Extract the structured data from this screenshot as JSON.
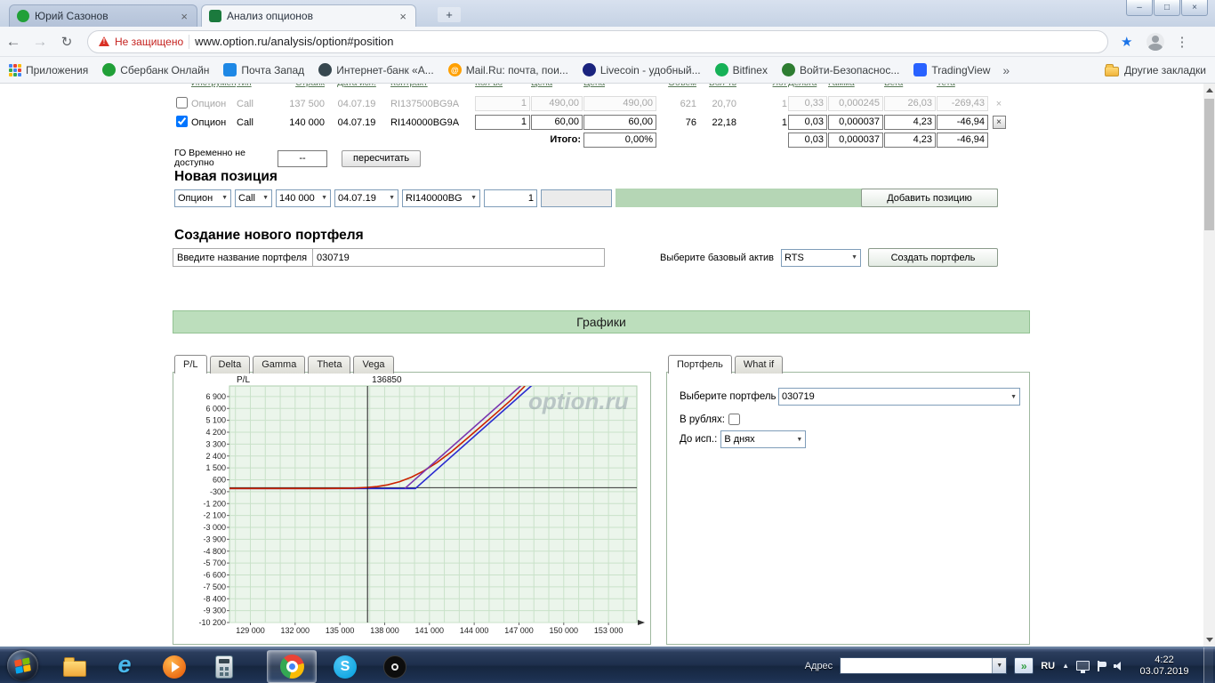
{
  "icons": {
    "close": "×",
    "plus": "+",
    "back": "←",
    "forward": "→",
    "reload": "↻",
    "menu": "⋮",
    "star": "★",
    "dropdown": "▼",
    "overflow": "»",
    "caret_up": "▲",
    "minimize": "–",
    "maximize": "□",
    "go": "»"
  },
  "window": {
    "tabs": [
      {
        "title": "Юрий Сазонов"
      },
      {
        "title": "Анализ опционов"
      }
    ]
  },
  "browser": {
    "security_label": "Не защищено",
    "url": "www.option.ru/analysis/option#position"
  },
  "bookmarks_bar": {
    "items": [
      {
        "label": "Приложения",
        "icon": "apps-grid-icon",
        "grid_colors": [
          "#4285f4",
          "#ea4335",
          "#fbbc05",
          "#34a853",
          "#4285f4",
          "#ea4335",
          "#fbbc05",
          "#34a853",
          "#4285f4"
        ]
      },
      {
        "label": "Сбербанк Онлайн",
        "icon": "sberbank-favicon",
        "shape": "circle",
        "color": "#21a038"
      },
      {
        "label": "Почта Запад",
        "icon": "pochta-favicon",
        "shape": "square",
        "color": "#1e88e5"
      },
      {
        "label": "Интернет-банк «А...",
        "icon": "internet-bank-favicon",
        "shape": "circle",
        "color": "#37474f"
      },
      {
        "label": "Mail.Ru: почта, пои...",
        "icon": "mailru-favicon",
        "shape": "circle",
        "color": "#ffa000",
        "glyph": "@"
      },
      {
        "label": "Livecoin - удобный...",
        "icon": "livecoin-favicon",
        "shape": "circle",
        "color": "#1a237e"
      },
      {
        "label": "Bitfinex",
        "icon": "bitfinex-favicon",
        "shape": "circle",
        "color": "#16b157"
      },
      {
        "label": "Войти-Безопаснос...",
        "icon": "secure-login-favicon",
        "shape": "circle",
        "color": "#2e7d32"
      },
      {
        "label": "TradingView",
        "icon": "tradingview-favicon",
        "shape": "square",
        "color": "#2962ff"
      }
    ],
    "other_label": "Другие закладки"
  },
  "positions_table": {
    "headers": [
      "Инструмент",
      "Тип",
      "Страйк",
      "Дата исп.",
      "Контракт",
      "Кол-во",
      "Цена",
      "Цена",
      "Объем",
      "Вол-ть",
      "Лот",
      "Дельта",
      "Гамма",
      "Вега",
      "Тета"
    ],
    "rows": [
      {
        "enabled": false,
        "instrument": "Опцион",
        "type": "Call",
        "strike": "137 500",
        "date": "04.07.19",
        "contract": "RI137500BG9A",
        "qty": "1",
        "price": "490,00",
        "price2": "490,00",
        "volume": "621",
        "volat": "20,70",
        "lot": "1",
        "delta": "0,33",
        "gamma": "0,000245",
        "vega": "26,03",
        "theta": "-269,43"
      },
      {
        "enabled": true,
        "instrument": "Опцион",
        "type": "Call",
        "strike": "140 000",
        "date": "04.07.19",
        "contract": "RI140000BG9A",
        "qty": "1",
        "price": "60,00",
        "price2": "60,00",
        "volume": "76",
        "volat": "22,18",
        "lot": "1",
        "delta": "0,03",
        "gamma": "0,000037",
        "vega": "4,23",
        "theta": "-46,94"
      }
    ],
    "totals": {
      "label": "Итого:",
      "percent": "0,00%",
      "delta": "0,03",
      "gamma": "0,000037",
      "vega": "4,23",
      "theta": "-46,94"
    }
  },
  "go_block": {
    "label": "ГО Временно не доступно",
    "value": "--",
    "recalc_button": "пересчитать"
  },
  "new_position": {
    "title": "Новая позиция",
    "instrument": "Опцион",
    "type": "Call",
    "strike": "140 000",
    "date": "04.07.19",
    "contract": "RI140000BG",
    "qty": "1",
    "qty2": "",
    "add_button": "Добавить позицию"
  },
  "new_portfolio": {
    "title": "Создание нового портфеля",
    "name_label": "Введите название портфеля",
    "name_value": "030719",
    "asset_label": "Выберите базовый актив",
    "asset_value": "RTS",
    "create_button": "Создать портфель"
  },
  "charts_section": {
    "banner": "Графики",
    "chart_tabs": [
      "P/L",
      "Delta",
      "Gamma",
      "Theta",
      "Vega"
    ],
    "portfolio_tabs": [
      "Портфель",
      "What if"
    ]
  },
  "chart_data": {
    "type": "line",
    "ylabel": "P/L",
    "marker_label": "136850",
    "marker_x": 136850,
    "watermark": "option.ru",
    "xlim": [
      127600,
      154900
    ],
    "ylim": [
      -10200,
      7700
    ],
    "x_tick_values": [
      129000,
      132000,
      135000,
      138000,
      141000,
      144000,
      147000,
      150000,
      153000
    ],
    "x_tick_labels": [
      "129 000",
      "132 000",
      "135 000",
      "138 000",
      "141 000",
      "144 000",
      "147 000",
      "150 000",
      "153 000"
    ],
    "y_tick_values": [
      6900,
      6000,
      5100,
      4200,
      3300,
      2400,
      1500,
      600,
      -300,
      -1200,
      -2100,
      -3000,
      -3900,
      -4800,
      -5700,
      -6600,
      -7500,
      -8400,
      -9300,
      -10200
    ],
    "y_tick_labels": [
      "6 900",
      "6 000",
      "5 100",
      "4 200",
      "3 300",
      "2 400",
      "1 500",
      "600",
      "-300",
      "-1 200",
      "-2 100",
      "-3 000",
      "-3 900",
      "-4 800",
      "-5 700",
      "-6 600",
      "-7 500",
      "-8 400",
      "-9 300",
      "-10 200"
    ],
    "grid_x_step": 1000,
    "zero_line": 0,
    "colors": {
      "grid": "#c9e2c9",
      "plot_bg": "#ebf5eb",
      "marker": "#1a1a1a",
      "zero": "#333333"
    },
    "series": [
      {
        "name": "expiration-payoff",
        "color": "#2a2ad0",
        "points": [
          [
            127600,
            -60
          ],
          [
            140060,
            -60
          ],
          [
            148500,
            8380
          ]
        ]
      },
      {
        "name": "current-pl",
        "color": "#cc2200",
        "points": [
          [
            127600,
            -60
          ],
          [
            132000,
            -60
          ],
          [
            134000,
            -58
          ],
          [
            135000,
            -50
          ],
          [
            136000,
            -25
          ],
          [
            136850,
            20
          ],
          [
            137500,
            90
          ],
          [
            138200,
            220
          ],
          [
            139000,
            460
          ],
          [
            139800,
            800
          ],
          [
            140600,
            1260
          ],
          [
            141500,
            1900
          ],
          [
            142500,
            2750
          ],
          [
            143500,
            3700
          ],
          [
            144500,
            4680
          ],
          [
            145500,
            5670
          ],
          [
            146500,
            6670
          ],
          [
            147400,
            7700
          ]
        ]
      },
      {
        "name": "combined-pl",
        "color": "#7a35b0",
        "points": [
          [
            139350,
            -60
          ],
          [
            147450,
            8040
          ]
        ]
      }
    ]
  },
  "portfolio_panel": {
    "select_label": "Выберите портфель",
    "portfolio_value": "030719",
    "rub_label": "В рублях:",
    "until_label": "До исп.:",
    "until_value": "В днях"
  },
  "taskbar": {
    "address_label": "Адрес",
    "lang": "RU",
    "time": "4:22",
    "date": "03.07.2019"
  }
}
